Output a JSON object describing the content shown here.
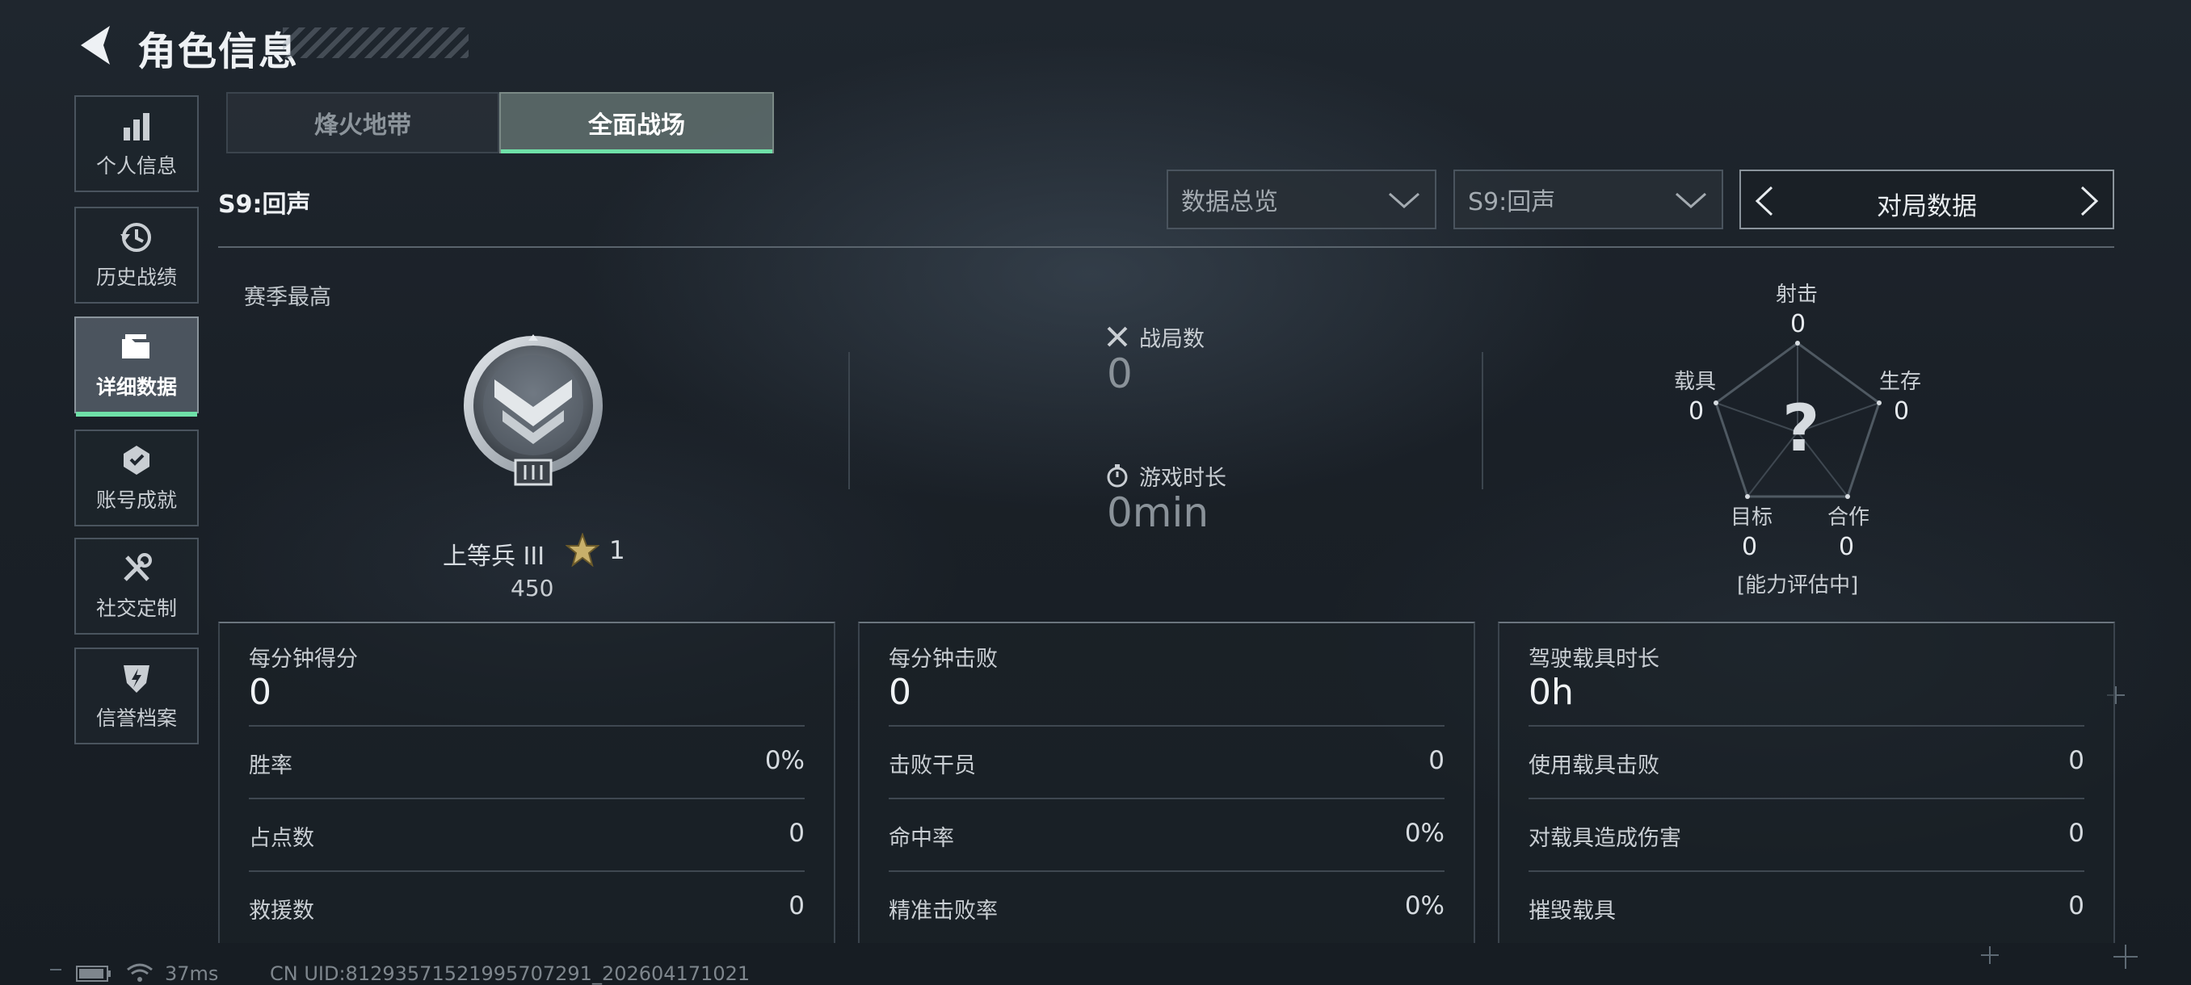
{
  "header": {
    "title": "角色信息",
    "back_icon": "back-arrow-icon"
  },
  "sidebar": {
    "items": [
      {
        "label": "个人信息",
        "icon": "bar-chart-icon",
        "active": false
      },
      {
        "label": "历史战绩",
        "icon": "history-clock-icon",
        "active": false
      },
      {
        "label": "详细数据",
        "icon": "folder-icon",
        "active": true
      },
      {
        "label": "账号成就",
        "icon": "achievement-badge-icon",
        "active": false
      },
      {
        "label": "社交定制",
        "icon": "tools-icon",
        "active": false
      },
      {
        "label": "信誉档案",
        "icon": "shield-bolt-icon",
        "active": false
      }
    ]
  },
  "tabs": [
    {
      "label": "烽火地带",
      "active": false
    },
    {
      "label": "全面战场",
      "active": true
    }
  ],
  "season_label": "S9:回声",
  "filters": {
    "overview": {
      "value": "数据总览"
    },
    "season": {
      "value": "S9:回声"
    },
    "pager": {
      "label": "对局数据"
    }
  },
  "season_best": {
    "label": "赛季最高",
    "rank_name": "上等兵 III",
    "stars": "1",
    "score": "450"
  },
  "summary": {
    "matches": {
      "label": "战局数",
      "value": "0",
      "icon": "crossed-swords-icon"
    },
    "playtime": {
      "label": "游戏时长",
      "value": "0min",
      "icon": "stopwatch-icon"
    }
  },
  "radar": {
    "center_glyph": "?",
    "status": "[能力评估中]",
    "axes": [
      {
        "label": "射击",
        "value": "0"
      },
      {
        "label": "生存",
        "value": "0"
      },
      {
        "label": "合作",
        "value": "0"
      },
      {
        "label": "目标",
        "value": "0"
      },
      {
        "label": "载具",
        "value": "0"
      }
    ]
  },
  "cards": [
    {
      "head_label": "每分钟得分",
      "head_value": "0",
      "rows": [
        {
          "label": "胜率",
          "value": "0%"
        },
        {
          "label": "占点数",
          "value": "0"
        },
        {
          "label": "救援数",
          "value": "0"
        }
      ]
    },
    {
      "head_label": "每分钟击败",
      "head_value": "0",
      "rows": [
        {
          "label": "击败干员",
          "value": "0"
        },
        {
          "label": "命中率",
          "value": "0%"
        },
        {
          "label": "精准击败率",
          "value": "0%"
        }
      ]
    },
    {
      "head_label": "驾驶载具时长",
      "head_value": "0h",
      "rows": [
        {
          "label": "使用载具击败",
          "value": "0"
        },
        {
          "label": "对载具造成伤害",
          "value": "0"
        },
        {
          "label": "摧毁载具",
          "value": "0"
        }
      ]
    }
  ],
  "status_bar": {
    "ping": "37ms",
    "uid": "CN UID:812935715219957072​91_202604171021"
  },
  "colors": {
    "accent": "#6fe0a8",
    "panel_border": "#4a545e"
  }
}
